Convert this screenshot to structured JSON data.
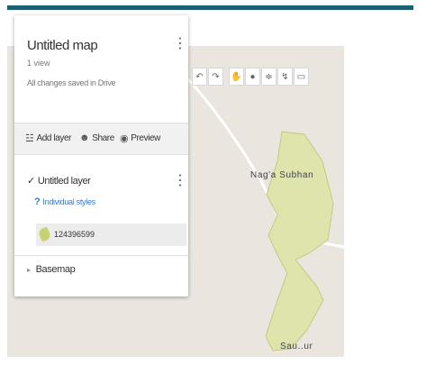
{
  "panel": {
    "title": "Untitled map",
    "views": "1 view",
    "save_status": "All changes saved in Drive",
    "menu_icon": "kebab-menu-icon",
    "actions": [
      {
        "label": "Add layer",
        "icon": "add-layer-icon"
      },
      {
        "label": "Share",
        "icon": "share-person-icon"
      },
      {
        "label": "Preview",
        "icon": "preview-eye-icon"
      }
    ]
  },
  "layer": {
    "name": "Untitled layer",
    "checked": true,
    "styles_label": "Individual styles",
    "feature_label": "124396599",
    "feature_color": "#c9d270"
  },
  "basemap": {
    "label": "Basemap"
  },
  "toolbar": {
    "tools": [
      "undo-icon",
      "redo-icon",
      "pan-hand-icon",
      "marker-icon",
      "draw-line-icon",
      "directions-icon",
      "ruler-icon"
    ]
  },
  "map": {
    "place_labels": [
      "Nag'a Subhan",
      "Sau..ur"
    ],
    "polygon_color": "#dfe4ad",
    "background_color": "#eae6df"
  }
}
